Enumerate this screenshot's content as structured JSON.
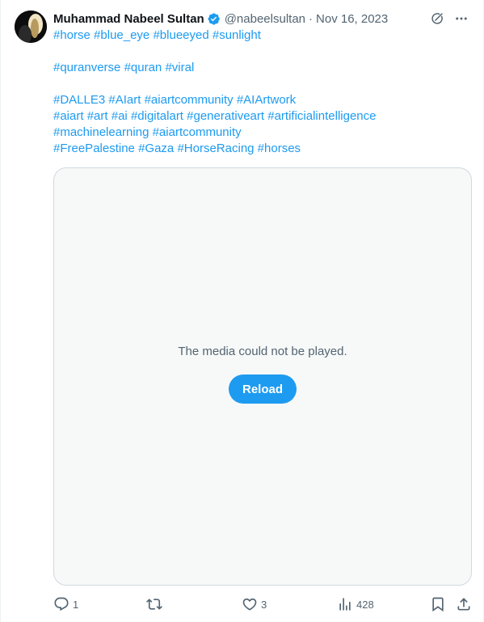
{
  "tweet": {
    "author_name": "Muhammad Nabeel Sultan",
    "handle": "@nabeelsultan",
    "separator": "·",
    "date": "Nov 16, 2023",
    "verified": true,
    "lines": [
      [
        "#horse",
        "#blue_eye",
        "#blueeyed",
        "#sunlight"
      ],
      [],
      [
        "#quranverse",
        "#quran",
        "#viral"
      ],
      [],
      [
        "#DALLE3",
        "#AIart",
        "#aiartcommunity",
        "#AIArtwork"
      ],
      [
        "#aiart",
        "#art",
        "#ai",
        "#digitalart",
        "#generativeart",
        "#artificialintelligence"
      ],
      [
        "#machinelearning",
        "#aiartcommunity"
      ],
      [
        "#FreePalestine",
        "#Gaza",
        "#HorseRacing",
        "#horses"
      ]
    ]
  },
  "media": {
    "message": "The media could not be played.",
    "reload_label": "Reload"
  },
  "stats": {
    "replies": "1",
    "retweets": "",
    "likes": "3",
    "views": "428"
  },
  "colors": {
    "accent": "#1d9bf0",
    "text": "#0f1419",
    "secondary": "#536471"
  },
  "icons": {
    "grok": "grok-icon",
    "more": "more-icon",
    "reply": "reply-icon",
    "retweet": "retweet-icon",
    "like": "like-icon",
    "views": "views-icon",
    "bookmark": "bookmark-icon",
    "share": "share-icon"
  }
}
